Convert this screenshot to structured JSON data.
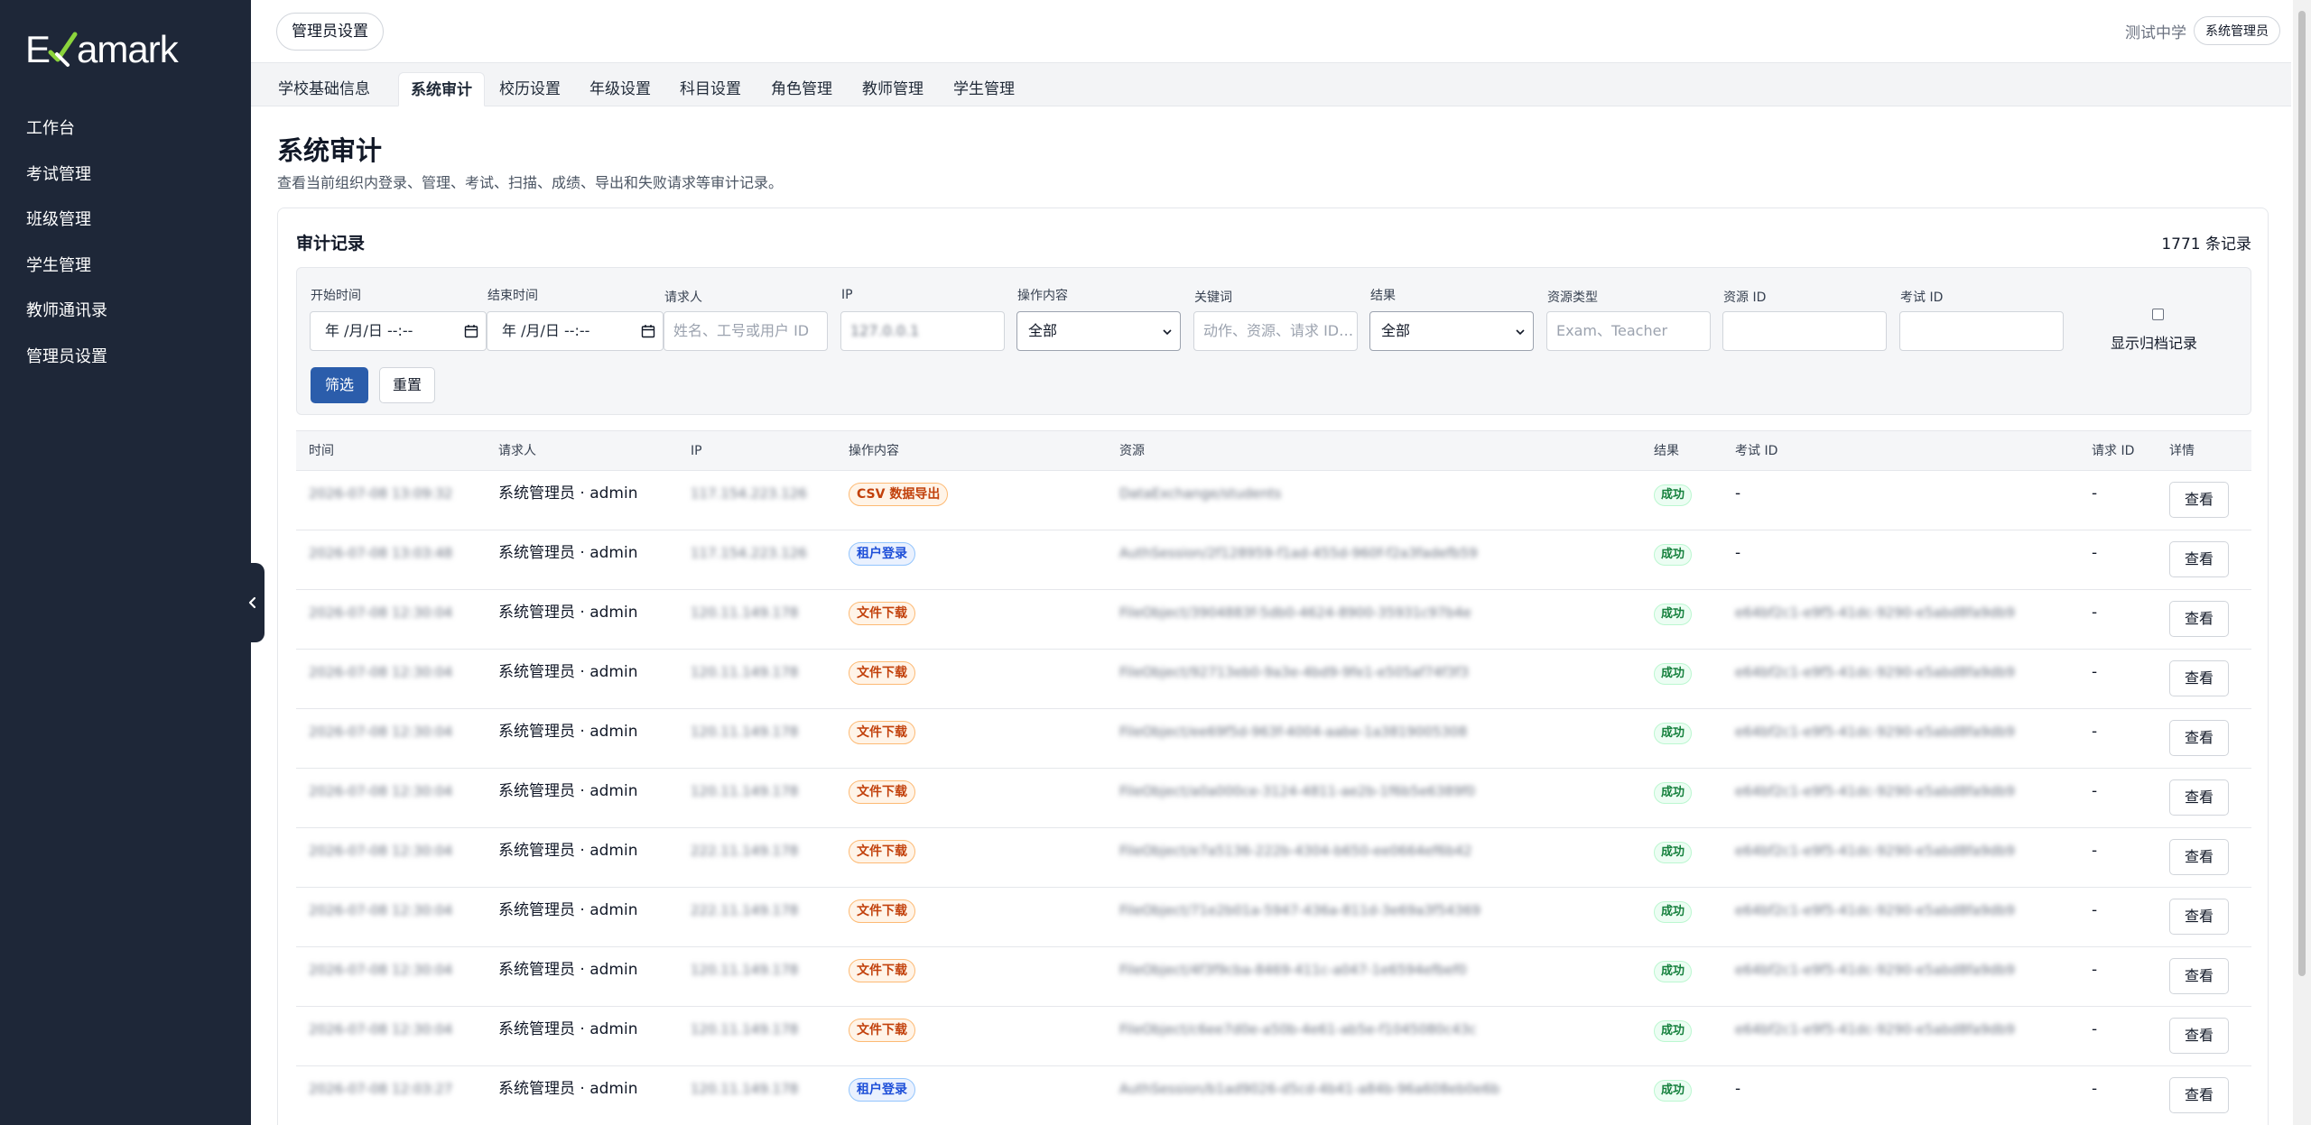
{
  "brand": {
    "logo_text_left": "E",
    "logo_text_right": "amark",
    "logo_text_full": "Examark"
  },
  "sidebar": {
    "items": [
      {
        "label": "工作台"
      },
      {
        "label": "考试管理"
      },
      {
        "label": "班级管理"
      },
      {
        "label": "学生管理"
      },
      {
        "label": "教师通讯录"
      },
      {
        "label": "管理员设置"
      }
    ]
  },
  "header": {
    "current_page": "管理员设置",
    "school_name": "测试中学",
    "user_role": "系统管理员"
  },
  "tabs": [
    {
      "label": "学校基础信息"
    },
    {
      "label": "系统审计",
      "active": true
    },
    {
      "label": "校历设置"
    },
    {
      "label": "年级设置"
    },
    {
      "label": "科目设置"
    },
    {
      "label": "角色管理"
    },
    {
      "label": "教师管理"
    },
    {
      "label": "学生管理"
    }
  ],
  "page": {
    "title": "系统审计",
    "description": "查看当前组织内登录、管理、考试、扫描、成绩、导出和失败请求等审计记录。"
  },
  "audit": {
    "card_title": "审计记录",
    "record_count": "1771 条记录",
    "filters": {
      "start_time": {
        "label": "开始时间",
        "value": "年 /月/日 --:--"
      },
      "end_time": {
        "label": "结束时间",
        "value": "年 /月/日 --:--"
      },
      "requester": {
        "label": "请求人",
        "placeholder": "姓名、工号或用户 ID"
      },
      "ip": {
        "label": "IP",
        "value": "127.0.0.1"
      },
      "action": {
        "label": "操作内容",
        "value": "全部"
      },
      "keyword": {
        "label": "关键词",
        "placeholder": "动作、资源、请求 ID…"
      },
      "result": {
        "label": "结果",
        "value": "全部"
      },
      "resource_type": {
        "label": "资源类型",
        "placeholder": "Exam、Teacher"
      },
      "resource_id": {
        "label": "资源 ID",
        "value": ""
      },
      "exam_id": {
        "label": "考试 ID",
        "value": ""
      },
      "show_archived": {
        "label": "显示归档记录",
        "checked": false
      },
      "filter_button": "筛选",
      "reset_button": "重置"
    },
    "columns": {
      "time": "时间",
      "requester": "请求人",
      "ip": "IP",
      "action": "操作内容",
      "resource": "资源",
      "result": "结果",
      "exam_id": "考试 ID",
      "request_id": "请求 ID",
      "details": "详情"
    },
    "rows": [
      {
        "time": "2026-07-08 13:09:32",
        "requester": "系统管理员 · admin",
        "ip": "117.154.223.126",
        "action": "CSV 数据导出",
        "action_kind": "orange",
        "resource": "DataExchange/students",
        "result": "成功",
        "exam_id": "-",
        "request_id": "-",
        "view": "查看"
      },
      {
        "time": "2026-07-08 13:03:48",
        "requester": "系统管理员 · admin",
        "ip": "117.154.223.126",
        "action": "租户登录",
        "action_kind": "blue",
        "resource": "AuthSession/2f128959-f1ad-455d-960f-f2a3fadefb59",
        "result": "成功",
        "exam_id": "-",
        "request_id": "-",
        "view": "查看"
      },
      {
        "time": "2026-07-08 12:30:04",
        "requester": "系统管理员 · admin",
        "ip": "120.11.149.178",
        "action": "文件下载",
        "action_kind": "orange",
        "resource": "FileObject/3904883f-5db0-4624-8900-35931c97b4e",
        "result": "成功",
        "exam_id": "e64bf2c1-e9f5-41dc-9290-e5abd8fa9db9",
        "request_id": "-",
        "view": "查看"
      },
      {
        "time": "2026-07-08 12:30:04",
        "requester": "系统管理员 · admin",
        "ip": "120.11.149.178",
        "action": "文件下载",
        "action_kind": "orange",
        "resource": "FileObject/92713eb0-9a3e-4bd9-9fe1-e505af74f3f3",
        "result": "成功",
        "exam_id": "e64bf2c1-e9f5-41dc-9290-e5abd8fa9db9",
        "request_id": "-",
        "view": "查看"
      },
      {
        "time": "2026-07-08 12:30:04",
        "requester": "系统管理员 · admin",
        "ip": "120.11.149.178",
        "action": "文件下载",
        "action_kind": "orange",
        "resource": "FileObject/ee69f5d-963f-4004-aabe-1a3819005308",
        "result": "成功",
        "exam_id": "e64bf2c1-e9f5-41dc-9290-e5abd8fa9db9",
        "request_id": "-",
        "view": "查看"
      },
      {
        "time": "2026-07-08 12:30:04",
        "requester": "系统管理员 · admin",
        "ip": "120.11.149.178",
        "action": "文件下载",
        "action_kind": "orange",
        "resource": "FileObject/a0a000ce-3124-4811-ae2b-1f6b5e6389f0",
        "result": "成功",
        "exam_id": "e64bf2c1-e9f5-41dc-9290-e5abd8fa9db9",
        "request_id": "-",
        "view": "查看"
      },
      {
        "time": "2026-07-08 12:30:04",
        "requester": "系统管理员 · admin",
        "ip": "222.11.149.178",
        "action": "文件下载",
        "action_kind": "orange",
        "resource": "FileObject/e7a5136-222b-4304-b650-ee0664ef6b42",
        "result": "成功",
        "exam_id": "e64bf2c1-e9f5-41dc-9290-e5abd8fa9db9",
        "request_id": "-",
        "view": "查看"
      },
      {
        "time": "2026-07-08 12:30:04",
        "requester": "系统管理员 · admin",
        "ip": "222.11.149.178",
        "action": "文件下载",
        "action_kind": "orange",
        "resource": "FileObject/71e2b01a-5947-436a-811d-3e69a3f54369",
        "result": "成功",
        "exam_id": "e64bf2c1-e9f5-41dc-9290-e5abd8fa9db9",
        "request_id": "-",
        "view": "查看"
      },
      {
        "time": "2026-07-08 12:30:04",
        "requester": "系统管理员 · admin",
        "ip": "120.11.149.178",
        "action": "文件下载",
        "action_kind": "orange",
        "resource": "FileObject/4f3f9cba-8469-411c-a047-1e6594efbef0",
        "result": "成功",
        "exam_id": "e64bf2c1-e9f5-41dc-9290-e5abd8fa9db9",
        "request_id": "-",
        "view": "查看"
      },
      {
        "time": "2026-07-08 12:30:04",
        "requester": "系统管理员 · admin",
        "ip": "120.11.149.178",
        "action": "文件下载",
        "action_kind": "orange",
        "resource": "FileObject/c6ee7d0e-a50b-4e61-ab5e-f1045080c43c",
        "result": "成功",
        "exam_id": "e64bf2c1-e9f5-41dc-9290-e5abd8fa9db9",
        "request_id": "-",
        "view": "查看"
      },
      {
        "time": "2026-07-08 12:03:27",
        "requester": "系统管理员 · admin",
        "ip": "120.11.149.178",
        "action": "租户登录",
        "action_kind": "blue",
        "resource": "AuthSession/b1ad9026-d5cd-4b41-a84b-96a608eb0e6b",
        "result": "成功",
        "exam_id": "-",
        "request_id": "-",
        "view": "查看"
      }
    ]
  },
  "colors": {
    "sidebar_bg": "#1e2738",
    "primary": "#2b5dab",
    "badge_orange": "#c2410c",
    "badge_blue": "#1d4ed8",
    "badge_green": "#15803d",
    "logo_check": "#8bd43c"
  },
  "icons": [
    "examark-check-logo",
    "chevron-left-icon",
    "calendar-icon",
    "chevron-down-icon"
  ]
}
